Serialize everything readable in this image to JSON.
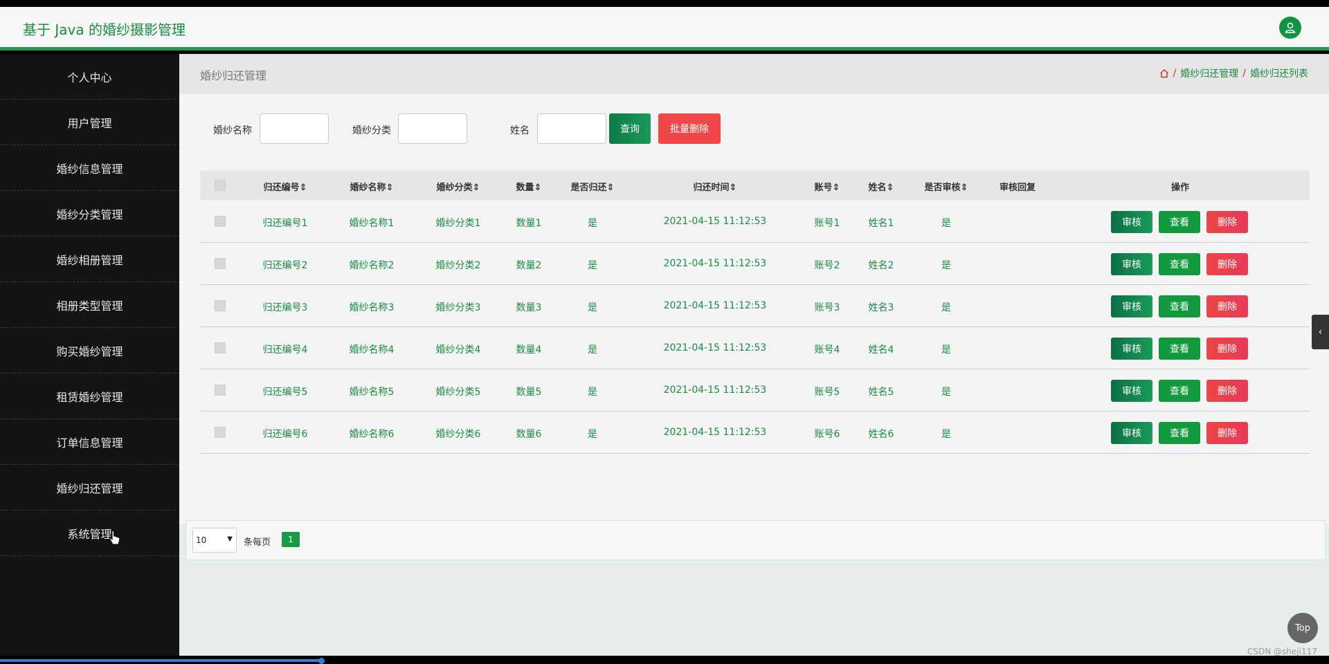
{
  "header": {
    "title": "基于 Java 的婚纱摄影管理"
  },
  "sidebar": {
    "items": [
      {
        "label": "个人中心"
      },
      {
        "label": "用户管理"
      },
      {
        "label": "婚纱信息管理"
      },
      {
        "label": "婚纱分类管理"
      },
      {
        "label": "婚纱相册管理"
      },
      {
        "label": "相册类型管理"
      },
      {
        "label": "购买婚纱管理"
      },
      {
        "label": "租赁婚纱管理"
      },
      {
        "label": "订单信息管理"
      },
      {
        "label": "婚纱归还管理"
      },
      {
        "label": "系统管理"
      }
    ]
  },
  "page": {
    "title": "婚纱归还管理"
  },
  "breadcrumb": {
    "home_icon": "home-icon",
    "separator": "/",
    "items": [
      "婚纱归还管理",
      "婚纱归还列表"
    ]
  },
  "search": {
    "name_label": "婚纱名称",
    "category_label": "婚纱分类",
    "person_label": "姓名",
    "query_button": "查询",
    "batch_delete_button": "批量删除"
  },
  "table": {
    "columns": [
      "归还编号",
      "婚纱名称",
      "婚纱分类",
      "数量",
      "是否归还",
      "归还时间",
      "账号",
      "姓名",
      "是否审核",
      "审核回复",
      "操作"
    ],
    "rows": [
      {
        "id": "归还编号1",
        "name": "婚纱名称1",
        "category": "婚纱分类1",
        "qty": "数量1",
        "returned": "是",
        "time": "2021-04-15 11:12:53",
        "account": "账号1",
        "person": "姓名1",
        "audited": "是",
        "reply": ""
      },
      {
        "id": "归还编号2",
        "name": "婚纱名称2",
        "category": "婚纱分类2",
        "qty": "数量2",
        "returned": "是",
        "time": "2021-04-15 11:12:53",
        "account": "账号2",
        "person": "姓名2",
        "audited": "是",
        "reply": ""
      },
      {
        "id": "归还编号3",
        "name": "婚纱名称3",
        "category": "婚纱分类3",
        "qty": "数量3",
        "returned": "是",
        "time": "2021-04-15 11:12:53",
        "account": "账号3",
        "person": "姓名3",
        "audited": "是",
        "reply": ""
      },
      {
        "id": "归还编号4",
        "name": "婚纱名称4",
        "category": "婚纱分类4",
        "qty": "数量4",
        "returned": "是",
        "time": "2021-04-15 11:12:53",
        "account": "账号4",
        "person": "姓名4",
        "audited": "是",
        "reply": ""
      },
      {
        "id": "归还编号5",
        "name": "婚纱名称5",
        "category": "婚纱分类5",
        "qty": "数量5",
        "returned": "是",
        "time": "2021-04-15 11:12:53",
        "account": "账号5",
        "person": "姓名5",
        "audited": "是",
        "reply": ""
      },
      {
        "id": "归还编号6",
        "name": "婚纱名称6",
        "category": "婚纱分类6",
        "qty": "数量6",
        "returned": "是",
        "time": "2021-04-15 11:12:53",
        "account": "账号6",
        "person": "姓名6",
        "audited": "是",
        "reply": ""
      }
    ],
    "actions": {
      "audit": "审核",
      "view": "查看",
      "delete": "删除"
    }
  },
  "pagination": {
    "page_size": "10",
    "per_page_label": "条每页",
    "current_page": "1"
  },
  "misc": {
    "top_button": "Top",
    "watermark": "CSDN @sheji117"
  },
  "video_progress": 0.24,
  "colors": {
    "accent": "#1a8a43",
    "sidebar_bg": "#141414",
    "danger": "#f04848"
  }
}
